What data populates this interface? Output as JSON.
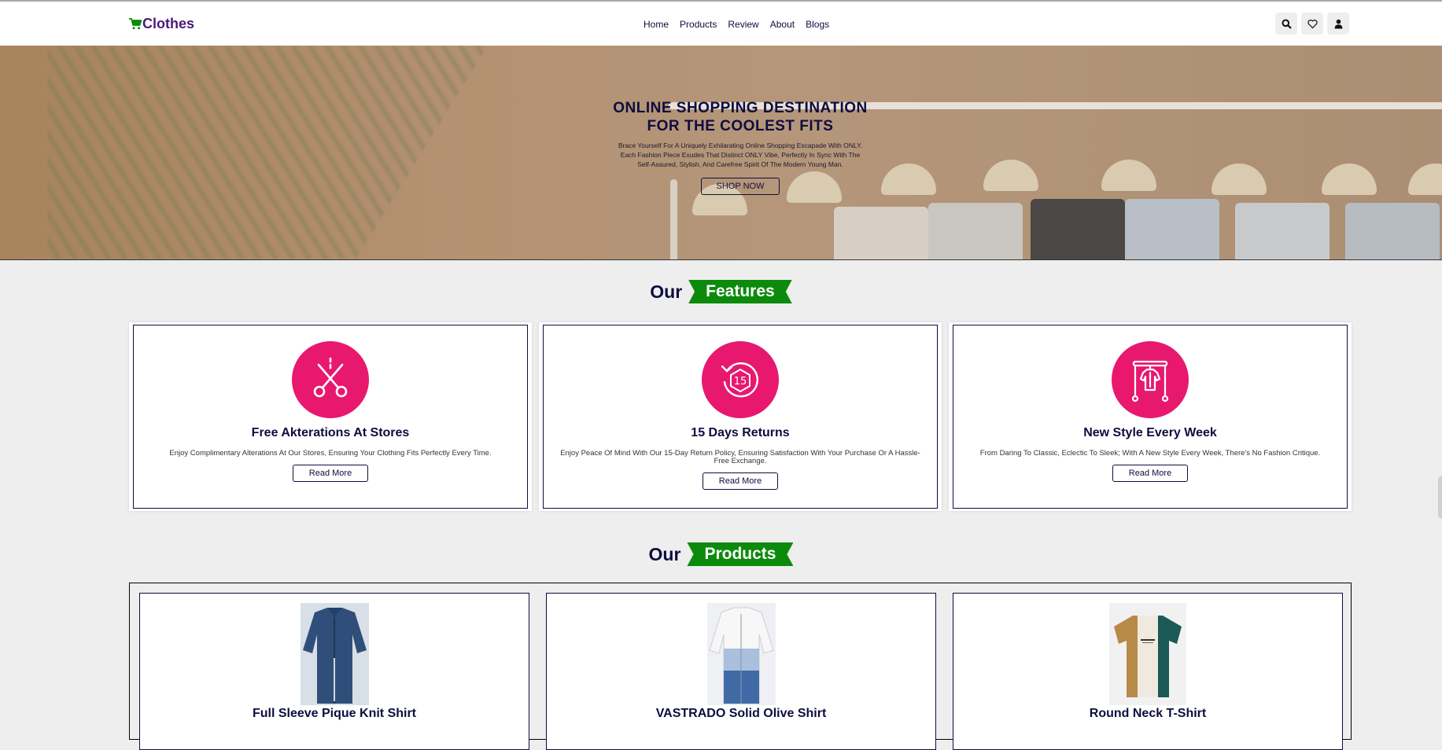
{
  "brand": {
    "name": "Clothes",
    "logo_color": "#4a1a7a",
    "cart_icon_color": "#0c8a0c"
  },
  "nav": {
    "items": [
      {
        "label": "Home"
      },
      {
        "label": "Products"
      },
      {
        "label": "Review"
      },
      {
        "label": "About"
      },
      {
        "label": "Blogs"
      }
    ]
  },
  "header_icons": [
    "search-icon",
    "heart-icon",
    "user-icon"
  ],
  "hero": {
    "title_line1": "ONLINE SHOPPING DESTINATION",
    "title_line2": "FOR THE COOLEST FITS",
    "subtitle_line1": "Brace Yourself For A Uniquely Exhilarating Online Shopping Escapade With ONLY.",
    "subtitle_line2": "Each Fashion Piece Exudes That Distinct ONLY Vibe, Perfectly In Sync With The",
    "subtitle_line3": "Self-Assured, Stylish, And Carefree Spirit Of The Modern Young Man.",
    "cta": "SHOP NOW"
  },
  "features_section": {
    "prefix": "Our",
    "highlight": "Features"
  },
  "features": [
    {
      "icon": "scissors-icon",
      "title": "Free Akterations At Stores",
      "description": "Enjoy Complimentary Alterations At Our Stores, Ensuring Your Clothing Fits Perfectly Every Time.",
      "button": "Read More"
    },
    {
      "icon": "15-day-return-icon",
      "title": "15 Days Returns",
      "description": "Enjoy Peace Of Mind With Our 15-Day Return Policy, Ensuring Satisfaction With Your Purchase Or A Hassle-Free Exchange.",
      "button": "Read More"
    },
    {
      "icon": "clothes-rack-icon",
      "title": "New Style Every Week",
      "description": "From Daring To Classic, Eclectic To Sleek; With A New Style Every Week, There's No Fashion Critique.",
      "button": "Read More"
    }
  ],
  "products_section": {
    "prefix": "Our",
    "highlight": "Products"
  },
  "products": [
    {
      "name": "Full Sleeve Pique Knit Shirt",
      "image": "denim-shirt"
    },
    {
      "name": "VASTRADO Solid Olive Shirt",
      "image": "blue-white-shirt"
    },
    {
      "name": "Round Neck T-Shirt",
      "image": "colorblock-tshirt"
    }
  ],
  "colors": {
    "accent_green": "#0c8a0c",
    "feature_pink": "#e8186f",
    "navy_text": "#0d0d3f"
  }
}
